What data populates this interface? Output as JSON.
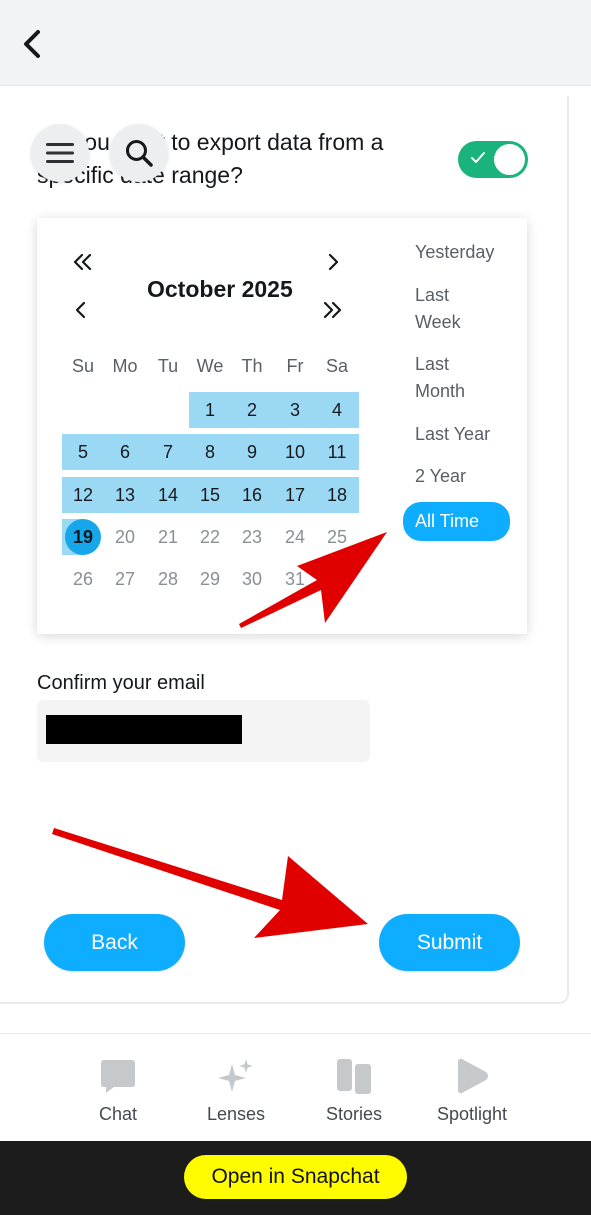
{
  "question": {
    "text": "Do you want to export data from a specific date range?"
  },
  "toggle": {
    "state": "on"
  },
  "calendar": {
    "month_title": "October 2025",
    "weekdays": [
      "Su",
      "Mo",
      "Tu",
      "We",
      "Th",
      "Fr",
      "Sa"
    ],
    "rows": [
      [
        "",
        "",
        "",
        "1",
        "2",
        "3",
        "4"
      ],
      [
        "5",
        "6",
        "7",
        "8",
        "9",
        "10",
        "11"
      ],
      [
        "12",
        "13",
        "14",
        "15",
        "16",
        "17",
        "18"
      ],
      [
        "19",
        "20",
        "21",
        "22",
        "23",
        "24",
        "25"
      ],
      [
        "26",
        "27",
        "28",
        "29",
        "30",
        "31",
        ""
      ]
    ],
    "selected_today": "19"
  },
  "presets": {
    "yesterday": "Yesterday",
    "last_week_1": "Last",
    "last_week_2": "Week",
    "last_month_1": "Last",
    "last_month_2": "Month",
    "last_year": "Last Year",
    "two_year": "2 Year",
    "all_time": "All Time"
  },
  "email": {
    "label": "Confirm your email"
  },
  "buttons": {
    "back": "Back",
    "submit": "Submit"
  },
  "bottom_nav": {
    "chat": "Chat",
    "lenses": "Lenses",
    "stories": "Stories",
    "spotlight": "Spotlight"
  },
  "banner": {
    "open_snapchat": "Open in Snapchat"
  },
  "colors": {
    "accent": "#0fadff",
    "range_highlight": "#9ad8f4",
    "toggle_on": "#19b37b",
    "snap_yellow": "#fffc00",
    "annotation_arrow": "#e00000"
  }
}
